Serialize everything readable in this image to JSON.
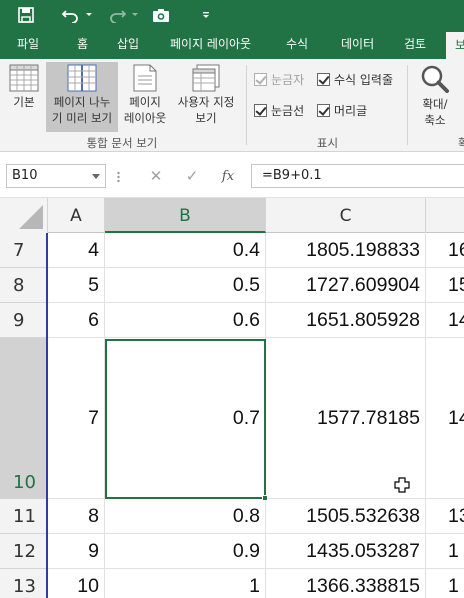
{
  "quick_access": {
    "icons": [
      "save-icon",
      "undo-icon",
      "redo-icon",
      "camera-icon",
      "customize-icon"
    ]
  },
  "tabs": [
    "파일",
    "홈",
    "삽입",
    "페이지 레이아웃",
    "수식",
    "데이터",
    "검토",
    "보"
  ],
  "ribbon": {
    "views": {
      "normal": "기본",
      "page_break_line1": "페이지 나누",
      "page_break_line2": "기 미리 보기",
      "page_layout_line1": "페이지",
      "page_layout_line2": "레이아웃",
      "custom_line1": "사용자 지정",
      "custom_line2": "보기",
      "group_label": "통합 문서 보기"
    },
    "show": {
      "ruler": "눈금자",
      "formula_bar": "수식 입력줄",
      "gridlines": "눈금선",
      "headings": "머리글",
      "group_label": "표시"
    },
    "zoom": {
      "label_line1": "확대/",
      "label_line2": "축소"
    }
  },
  "formula_bar": {
    "name_box": "B10",
    "fx": "fx",
    "formula": "=B9+0.1"
  },
  "grid": {
    "columns": [
      "A",
      "B",
      "C"
    ],
    "rows": [
      {
        "num": "7",
        "a": "4",
        "b": "0.4",
        "c": "1805.198833",
        "d": "16"
      },
      {
        "num": "8",
        "a": "5",
        "b": "0.5",
        "c": "1727.609904",
        "d": "15"
      },
      {
        "num": "9",
        "a": "6",
        "b": "0.6",
        "c": "1651.805928",
        "d": "14"
      },
      {
        "num": "10",
        "a": "7",
        "b": "0.7",
        "c": "1577.78185",
        "d": "14"
      },
      {
        "num": "11",
        "a": "8",
        "b": "0.8",
        "c": "1505.532638",
        "d": "13"
      },
      {
        "num": "12",
        "a": "9",
        "b": "0.9",
        "c": "1435.053287",
        "d": "1"
      },
      {
        "num": "13",
        "a": "10",
        "b": "1",
        "c": "1366.338815",
        "d": "1"
      }
    ],
    "selected_cell": "B10",
    "selected_row": "10",
    "selected_column": "B"
  },
  "colors": {
    "brand": "#217346",
    "ribbon_bg": "#f3f3f3",
    "header_bg": "#f3f3f3",
    "selected_header_bg": "#d2d2d2"
  }
}
